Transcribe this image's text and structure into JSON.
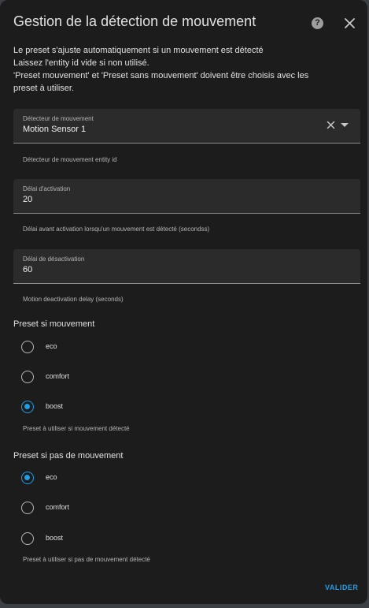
{
  "dialog": {
    "title": "Gestion de la détection de mouvement",
    "help_icon": "help-circle-icon",
    "close_icon": "close-icon",
    "description_lines": [
      "Le preset s'ajuste automatiquement si un mouvement est détecté",
      "Laissez l'entity id vide si non utilisé.",
      "'Preset mouvement' et 'Preset sans mouvement' doivent être choisis avec les",
      "preset à utiliser."
    ]
  },
  "motion_sensor": {
    "label": "Détecteur de mouvement",
    "value": "Motion Sensor 1",
    "helper": "Détecteur de mouvement entity id",
    "clear_icon": "clear-icon",
    "dropdown_icon": "dropdown-arrow-icon"
  },
  "activation_delay": {
    "label": "Délai d'activation",
    "value": "20",
    "helper": "Délai avant activation lorsqu'un mouvement est détecté (secondss)"
  },
  "deactivation_delay": {
    "label": "Délai de désactivation",
    "value": "60",
    "helper": "Motion deactivation delay (seconds)"
  },
  "preset_motion": {
    "title": "Preset si mouvement",
    "options": [
      {
        "label": "eco",
        "checked": false
      },
      {
        "label": "comfort",
        "checked": false
      },
      {
        "label": "boost",
        "checked": true
      }
    ],
    "helper": "Preset à utiliser si mouvement détecté"
  },
  "preset_no_motion": {
    "title": "Preset si pas de mouvement",
    "options": [
      {
        "label": "eco",
        "checked": true
      },
      {
        "label": "comfort",
        "checked": false
      },
      {
        "label": "boost",
        "checked": false
      }
    ],
    "helper": "Preset à utiliser si pas de mouvement détecté"
  },
  "actions": {
    "submit_label": "VALIDER"
  },
  "colors": {
    "accent": "#1e9fe8",
    "surface": "#1c1c1c",
    "field": "#2b2b2b"
  }
}
